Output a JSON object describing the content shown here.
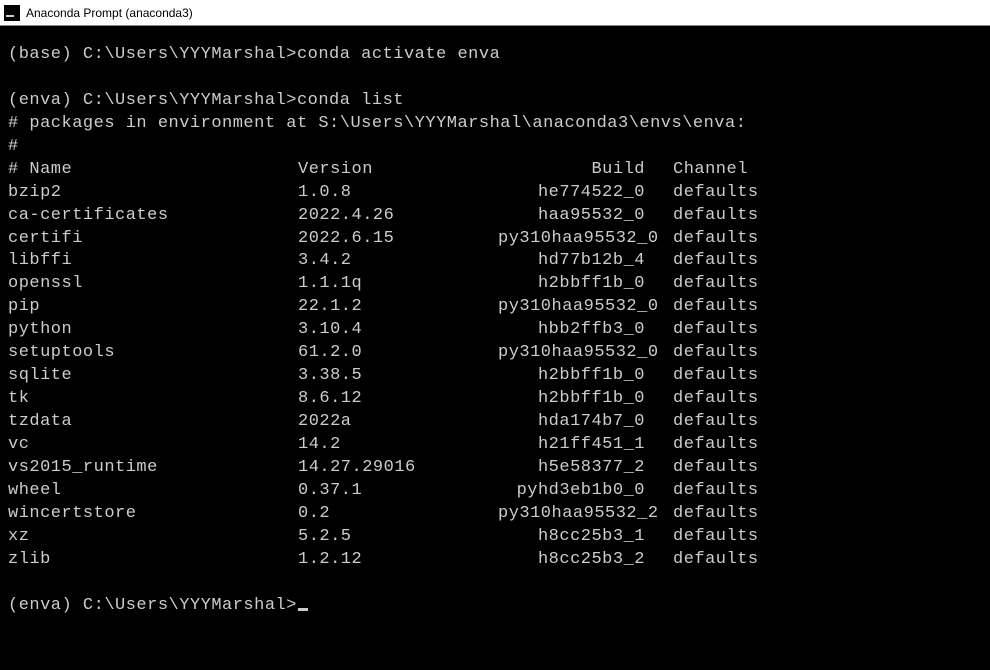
{
  "window": {
    "title": "Anaconda Prompt (anaconda3)"
  },
  "session": {
    "prompt1": "(base) C:\\Users\\YYYMarshal>",
    "cmd1": "conda activate enva",
    "prompt2": "(enva) C:\\Users\\YYYMarshal>",
    "cmd2": "conda list",
    "env_header": "# packages in environment at S:\\Users\\YYYMarshal\\anaconda3\\envs\\enva:",
    "hash_line": "#",
    "columns_line": "# Name                    Version                   Build  Channel",
    "prompt3": "(enva) C:\\Users\\YYYMarshal>"
  },
  "columns": {
    "name": "# Name",
    "version": "Version",
    "build": "Build",
    "channel": "Channel"
  },
  "packages": [
    {
      "name": "bzip2",
      "version": "1.0.8",
      "build": "he774522_0",
      "channel": "defaults"
    },
    {
      "name": "ca-certificates",
      "version": "2022.4.26",
      "build": "haa95532_0",
      "channel": "defaults"
    },
    {
      "name": "certifi",
      "version": "2022.6.15",
      "build": "py310haa95532_0",
      "channel": "defaults"
    },
    {
      "name": "libffi",
      "version": "3.4.2",
      "build": "hd77b12b_4",
      "channel": "defaults"
    },
    {
      "name": "openssl",
      "version": "1.1.1q",
      "build": "h2bbff1b_0",
      "channel": "defaults"
    },
    {
      "name": "pip",
      "version": "22.1.2",
      "build": "py310haa95532_0",
      "channel": "defaults"
    },
    {
      "name": "python",
      "version": "3.10.4",
      "build": "hbb2ffb3_0",
      "channel": "defaults"
    },
    {
      "name": "setuptools",
      "version": "61.2.0",
      "build": "py310haa95532_0",
      "channel": "defaults"
    },
    {
      "name": "sqlite",
      "version": "3.38.5",
      "build": "h2bbff1b_0",
      "channel": "defaults"
    },
    {
      "name": "tk",
      "version": "8.6.12",
      "build": "h2bbff1b_0",
      "channel": "defaults"
    },
    {
      "name": "tzdata",
      "version": "2022a",
      "build": "hda174b7_0",
      "channel": "defaults"
    },
    {
      "name": "vc",
      "version": "14.2",
      "build": "h21ff451_1",
      "channel": "defaults"
    },
    {
      "name": "vs2015_runtime",
      "version": "14.27.29016",
      "build": "h5e58377_2",
      "channel": "defaults"
    },
    {
      "name": "wheel",
      "version": "0.37.1",
      "build": "pyhd3eb1b0_0",
      "channel": "defaults"
    },
    {
      "name": "wincertstore",
      "version": "0.2",
      "build": "py310haa95532_2",
      "channel": "defaults"
    },
    {
      "name": "xz",
      "version": "5.2.5",
      "build": "h8cc25b3_1",
      "channel": "defaults"
    },
    {
      "name": "zlib",
      "version": "1.2.12",
      "build": "h8cc25b3_2",
      "channel": "defaults"
    }
  ]
}
